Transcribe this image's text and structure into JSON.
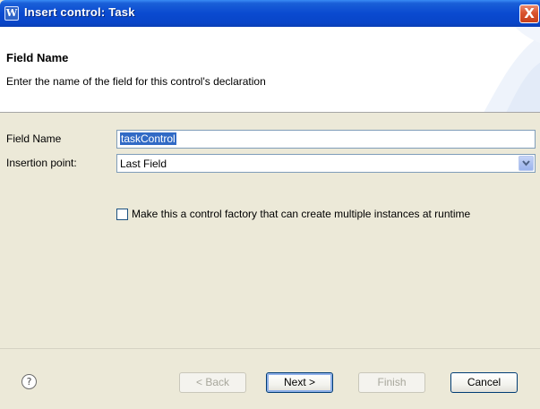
{
  "window": {
    "title": "Insert control: Task",
    "close_label": "X"
  },
  "banner": {
    "title": "Field Name",
    "description": "Enter the name of the field for this control's declaration"
  },
  "form": {
    "field_name_label": "Field Name",
    "field_name_value": "taskControl",
    "insertion_point_label": "Insertion point:",
    "insertion_point_value": "Last Field",
    "factory_checkbox_label": "Make this a control factory that can create multiple instances at runtime",
    "factory_checked": false
  },
  "footer": {
    "help_label": "?",
    "back_label": "< Back",
    "next_label": "Next >",
    "finish_label": "Finish",
    "cancel_label": "Cancel"
  },
  "colors": {
    "titlebar": "#0a4ad0",
    "selection": "#316ac5",
    "close": "#d9532e"
  }
}
